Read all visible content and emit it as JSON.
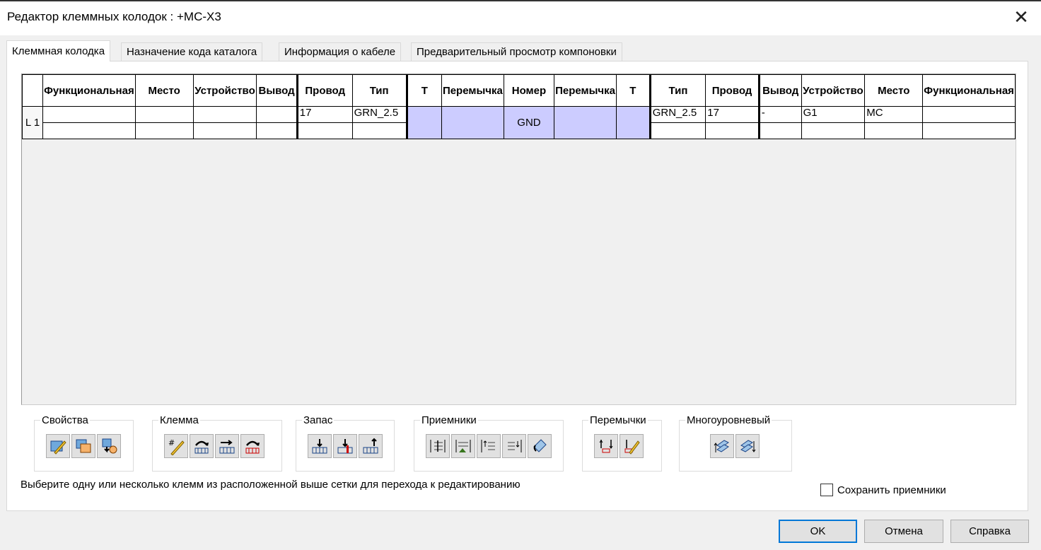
{
  "window": {
    "title": "Редактор клеммных колодок : +MC-X3"
  },
  "tabs": [
    {
      "label": "Клеммная колодка"
    },
    {
      "label": "Назначение кода каталога"
    },
    {
      "label": "Информация о кабеле"
    },
    {
      "label": "Предварительный просмотр компоновки"
    }
  ],
  "grid": {
    "headers": [
      "Функциональная",
      "Место",
      "Устройство",
      "Вывод",
      "Провод",
      "Тип",
      "Т",
      "Перемычка",
      "Номер",
      "Перемычка",
      "Т",
      "Тип",
      "Провод",
      "Вывод",
      "Устройство",
      "Место",
      "Функциональная"
    ],
    "row": {
      "label": "L 1",
      "left_wire": "17",
      "left_type": "GRN_2.5",
      "number": "GND",
      "right_type": "GRN_2.5",
      "right_wire": "17",
      "right_pin": "-",
      "right_device": "G1",
      "right_location": "MC"
    },
    "highlight_color": "#ccccff"
  },
  "toolbar_groups": {
    "properties": {
      "label": "Свойства",
      "icons": [
        "edit-properties-icon",
        "copy-properties-icon",
        "paste-properties-icon"
      ]
    },
    "terminal": {
      "label": "Клемма",
      "icons": [
        "edit-terminal-icon",
        "insert-terminal-icon",
        "move-terminal-icon",
        "reverse-terminal-icon"
      ]
    },
    "spare": {
      "label": "Запас",
      "icons": [
        "add-spare-icon",
        "delete-spare-icon",
        "insert-spare-icon"
      ]
    },
    "receivers": {
      "label": "Приемники",
      "icons": [
        "spread-receivers-icon",
        "add-receiver-icon",
        "move-receiver-up-icon",
        "move-receiver-down-icon",
        "swap-receivers-icon"
      ]
    },
    "jumpers": {
      "label": "Перемычки",
      "icons": [
        "add-jumper-icon",
        "edit-jumper-icon"
      ]
    },
    "multilevel": {
      "label": "Многоуровневый",
      "icons": [
        "level-up-icon",
        "level-down-icon"
      ]
    }
  },
  "hint_text": "Выберите одну или несколько клемм из расположенной выше сетки для перехода к редактированию",
  "keep_receivers_label": "Сохранить приемники",
  "buttons": {
    "ok": "OK",
    "cancel": "Отмена",
    "help": "Справка"
  }
}
